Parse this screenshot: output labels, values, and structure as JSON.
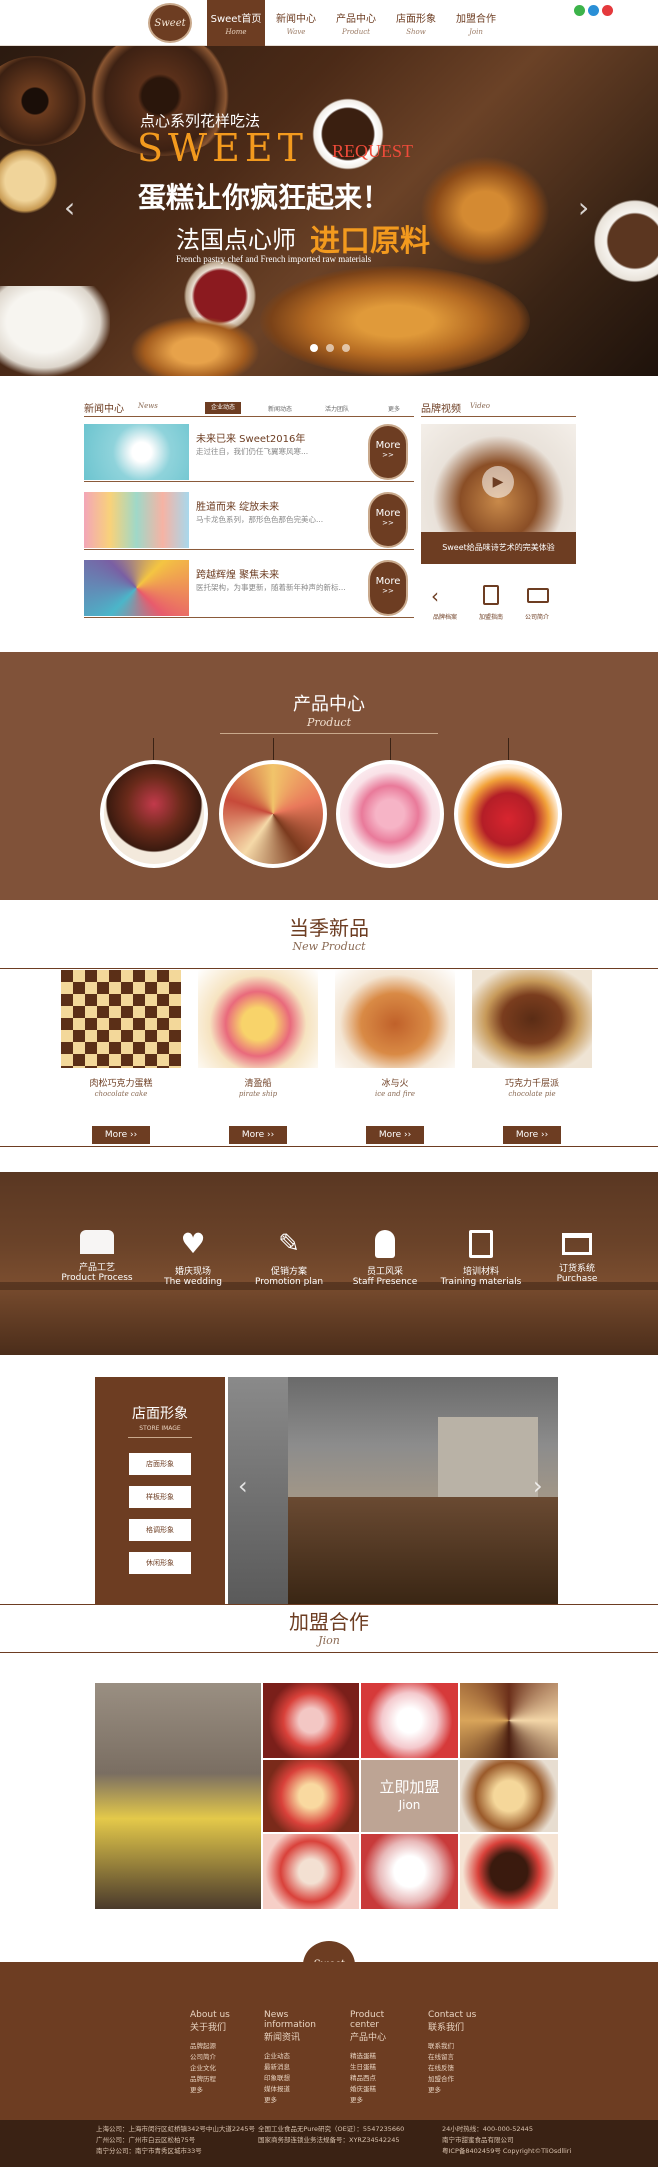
{
  "colors": {
    "brand": "#6d3d22",
    "product_bg": "#805239",
    "accent_orange": "#f39a1e"
  },
  "header": {
    "logo_text": "Sweet",
    "nav": [
      {
        "cn": "Sweet首页",
        "en": "Home",
        "active": true
      },
      {
        "cn": "新闻中心",
        "en": "Wave"
      },
      {
        "cn": "产品中心",
        "en": "Product"
      },
      {
        "cn": "店面形象",
        "en": "Show"
      },
      {
        "cn": "加盟合作",
        "en": "Join"
      }
    ],
    "social_icons": [
      "wechat-icon",
      "qq-icon",
      "weibo-icon"
    ]
  },
  "hero": {
    "line1": "点心系列花样吃法",
    "sweet": "SWEET",
    "request": "REQUEST",
    "line3": "蛋糕让你疯狂起来！",
    "line4a": "法国点心师",
    "line4b": "进口原料",
    "line5": "French pastry chef and French imported raw materials"
  },
  "news": {
    "title": "新闻中心",
    "title_en": "News",
    "tabs": [
      "企业动态",
      "新闻动态",
      "活力团队",
      "更多"
    ],
    "items": [
      {
        "title": "未来已来 Sweet2016年",
        "desc": "走过往自，我们仍任飞翼寒风寒..."
      },
      {
        "title": "胜道而来 绽放未来",
        "desc": "马卡龙色系列，那形色色那色完美心..."
      },
      {
        "title": "跨越辉煌 聚焦未来",
        "desc": "医托架构，为事更新，随着新年种声的新标..."
      }
    ],
    "more": "More",
    "more_arrow": ">>"
  },
  "video": {
    "title": "品牌视频",
    "title_en": "Video",
    "caption": "Sweet给品味诗艺术的完美体验",
    "links": [
      {
        "icon": "arrow-left-icon",
        "label": "品牌档案"
      },
      {
        "icon": "book-icon",
        "label": "加盟指南"
      },
      {
        "icon": "card-icon",
        "label": "公司简介"
      }
    ]
  },
  "product_center": {
    "title": "产品中心",
    "title_en": "Product"
  },
  "seasonal": {
    "title": "当季新品",
    "title_en": "New Product",
    "items": [
      {
        "name": "肉松巧克力蛋糕",
        "en": "chocolate cake"
      },
      {
        "name": "清盈船",
        "en": "pirate ship"
      },
      {
        "name": "冰与火",
        "en": "ice and fire"
      },
      {
        "name": "巧克力千层派",
        "en": "chocolate pie"
      }
    ],
    "btn": "More"
  },
  "services": [
    {
      "icon": "cake-icon",
      "cn": "产品工艺",
      "en": "Product Process"
    },
    {
      "icon": "heart-icon",
      "cn": "婚庆现场",
      "en": "The wedding"
    },
    {
      "icon": "pencil-icon",
      "cn": "促销方案",
      "en": "Promotion plan"
    },
    {
      "icon": "person-icon",
      "cn": "员工风采",
      "en": "Staff Presence"
    },
    {
      "icon": "document-icon",
      "cn": "培训材料",
      "en": "Training materials"
    },
    {
      "icon": "cart-icon",
      "cn": "订货系统",
      "en": "Purchase"
    }
  ],
  "store": {
    "title": "店面形象",
    "subtitle": "STORE IMAGE",
    "buttons": [
      "店面形象",
      "样板形象",
      "格调形象",
      "休闲形象"
    ]
  },
  "join": {
    "title": "加盟合作",
    "title_en": "Jion",
    "center_cn": "立即加盟",
    "center_en": "Jion"
  },
  "footer": {
    "logo_text": "Sweet",
    "columns": [
      {
        "en": "About us",
        "cn": "关于我们",
        "links": [
          "品牌起源",
          "公司简介",
          "企业文化",
          "品牌历程",
          "更多"
        ]
      },
      {
        "en": "News information",
        "cn": "新闻资讯",
        "links": [
          "企业动态",
          "最新消息",
          "印象联想",
          "媒体报道",
          "更多"
        ]
      },
      {
        "en": "Product center",
        "cn": "产品中心",
        "links": [
          "精选蛋糕",
          "生日蛋糕",
          "精品西点",
          "婚庆蛋糕",
          "更多"
        ]
      },
      {
        "en": "Contact us",
        "cn": "联系我们",
        "links": [
          "联系我们",
          "在线留言",
          "在线反馈",
          "加盟合作",
          "更多"
        ]
      }
    ],
    "bottom": {
      "left": [
        "上海公司：上海市闵行区虹桥镇342号中山大道2245号",
        "广州公司：广州市白云区松柏75号",
        "南宁分公司：南宁市青秀区城市33号"
      ],
      "middle": [
        "全国工业食品无Pure研究（OE证）：5547235660",
        "国家商务部连锁业务法规备号：XYRZ34542245"
      ],
      "right": [
        "24小时热线：400-000-52445",
        "南宁市甜蜜食品有限公司",
        "粤ICP备8402459号 Copyright©TliOsdlliri"
      ]
    }
  }
}
